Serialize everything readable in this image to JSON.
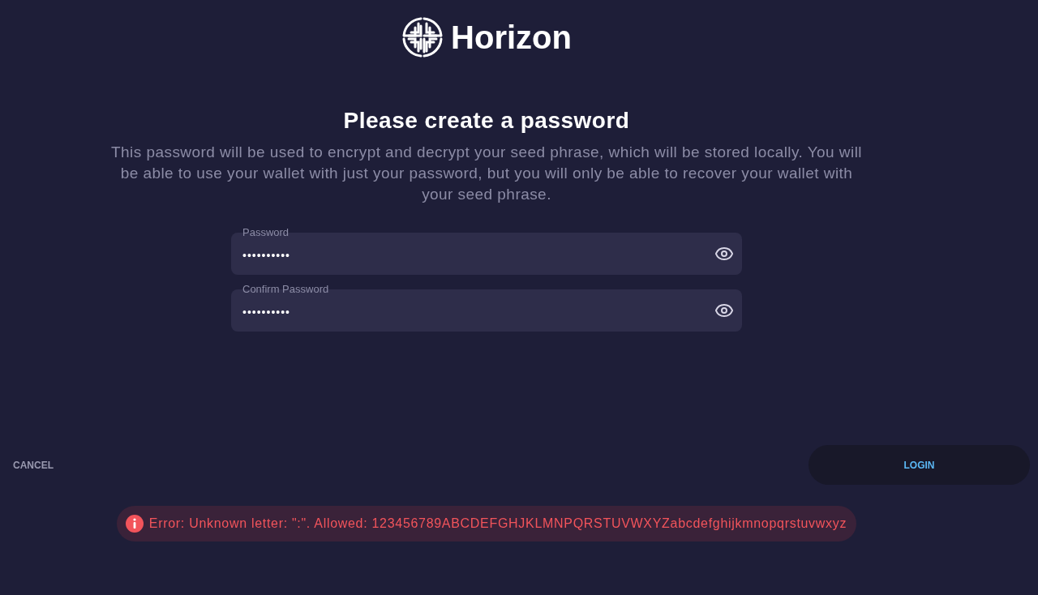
{
  "logo": {
    "name": "Horizon"
  },
  "heading": "Please create a password",
  "description": "This password will be used to encrypt and decrypt your seed phrase, which will be stored locally. You will be able to use your wallet with just your password, but you will only be able to recover your wallet with your seed phrase.",
  "fields": [
    {
      "label": "Password",
      "value": "••••••••••"
    },
    {
      "label": "Confirm Password",
      "value": "••••••••••"
    }
  ],
  "actions": {
    "cancel": "CANCEL",
    "login": "LOGIN"
  },
  "error": {
    "message": "Error: Unknown letter: \":\". Allowed: 123456789ABCDEFGHJKLMNPQRSTUVWXYZabcdefghijkmnopqrstuvwxyz"
  }
}
